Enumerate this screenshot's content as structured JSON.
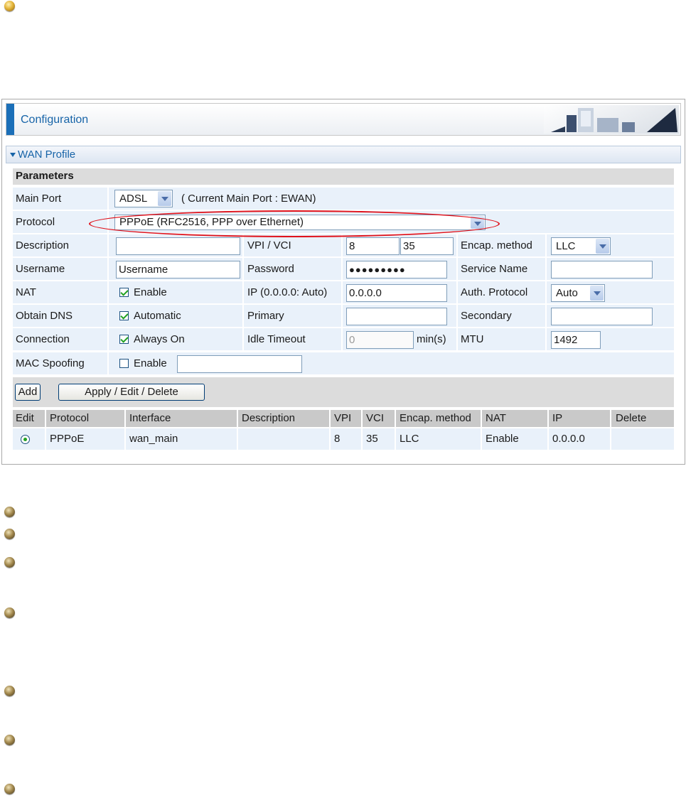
{
  "header": {
    "title": "Configuration"
  },
  "wan_profile": {
    "title": "WAN Profile"
  },
  "params": {
    "title": "Parameters",
    "main_port": {
      "label": "Main Port",
      "value": "ADSL",
      "current": "( Current Main Port : EWAN)"
    },
    "protocol": {
      "label": "Protocol",
      "value": "PPPoE (RFC2516, PPP over Ethernet)"
    },
    "description": {
      "label": "Description",
      "value": ""
    },
    "vpi_vci": {
      "label": "VPI / VCI",
      "vpi": "8",
      "sep": "/",
      "vci": "35"
    },
    "encap": {
      "label": "Encap. method",
      "value": "LLC"
    },
    "username": {
      "label": "Username",
      "value": "Username"
    },
    "password": {
      "label": "Password",
      "value": "●●●●●●●●●"
    },
    "service_name": {
      "label": "Service Name",
      "value": ""
    },
    "nat": {
      "label": "NAT",
      "checkbox_label": "Enable",
      "checked": true
    },
    "ip": {
      "label": "IP (0.0.0.0: Auto)",
      "value": "0.0.0.0"
    },
    "auth": {
      "label": "Auth. Protocol",
      "value": "Auto"
    },
    "obtain_dns": {
      "label": "Obtain DNS",
      "checkbox_label": "Automatic",
      "checked": true
    },
    "primary": {
      "label": "Primary",
      "value": ""
    },
    "secondary": {
      "label": "Secondary",
      "value": ""
    },
    "connection": {
      "label": "Connection",
      "checkbox_label": "Always On",
      "checked": true
    },
    "idle_timeout": {
      "label": "Idle Timeout",
      "value": "0",
      "unit": "min(s)"
    },
    "mtu": {
      "label": "MTU",
      "value": "1492"
    },
    "mac_spoofing": {
      "label": "MAC Spoofing",
      "checkbox_label": "Enable",
      "checked": false,
      "value": ""
    }
  },
  "buttons": {
    "add": "Add",
    "apply": "Apply / Edit / Delete"
  },
  "table": {
    "headers": [
      "Edit",
      "Protocol",
      "Interface",
      "Description",
      "VPI",
      "VCI",
      "Encap. method",
      "NAT",
      "IP",
      "Delete"
    ],
    "rows": [
      {
        "protocol": "PPPoE",
        "interface": "wan_main",
        "description": "",
        "vpi": "8",
        "vci": "35",
        "encap": "LLC",
        "nat": "Enable",
        "ip": "0.0.0.0",
        "delete": ""
      }
    ]
  },
  "colors": {
    "accent": "#1764a8",
    "highlight_ellipse": "#e0121b",
    "row_bg": "#e9f1fa"
  }
}
